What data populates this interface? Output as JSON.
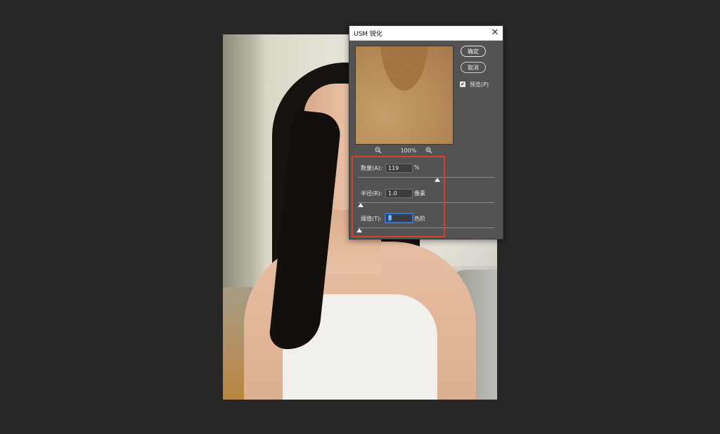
{
  "dialog": {
    "title": "USM 锐化",
    "close_glyph": "✕",
    "buttons": {
      "ok": "确定",
      "cancel": "取消"
    },
    "preview_checkbox": {
      "label": "预览(P)",
      "checked": true
    },
    "zoom": {
      "level": "100%",
      "zoom_out_icon": "zoom-out-icon",
      "zoom_in_icon": "zoom-in-icon"
    },
    "params": [
      {
        "label": "数量(A):",
        "value": "119",
        "unit": "%",
        "slider_fraction": 0.58
      },
      {
        "label": "半径(R):",
        "value": "1.0",
        "unit": "像素",
        "slider_fraction": 0.02
      },
      {
        "label": "阈值(T):",
        "value": "8",
        "unit": "色阶",
        "slider_fraction": 0.0,
        "focused": true
      }
    ]
  },
  "colors": {
    "dialog_bg": "#535353",
    "canvas_bg": "#272727",
    "highlight": "#d8402a",
    "focus": "#2f7ad6"
  }
}
